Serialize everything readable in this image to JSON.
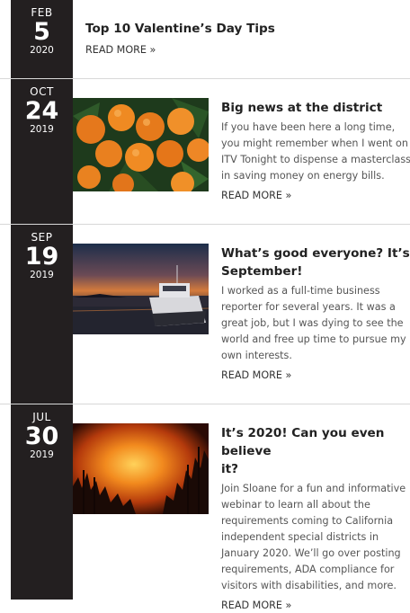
{
  "posts": [
    {
      "month": "FEB",
      "day": "5",
      "year": "2020",
      "title": "Top 10 Valentine’s Day Tips",
      "read_more": "READ MORE »",
      "body_lines": []
    },
    {
      "month": "OCT",
      "day": "24",
      "year": "2019",
      "title_lines": [
        "Big news at the district"
      ],
      "body_lines": [
        "If you have been here a long time,",
        "you might remember when I went on",
        "ITV Tonight to dispense a masterclass",
        "in saving money on energy bills."
      ],
      "read_more": "READ MORE »",
      "image": "oranges-photo"
    },
    {
      "month": "SEP",
      "day": "19",
      "year": "2019",
      "title_lines": [
        "What’s good everyone? It’s",
        "September!"
      ],
      "body_lines": [
        "I worked as a full-time business",
        "reporter for several years. It was a",
        "great job, but I was dying to see the",
        "world and free up time to pursue my",
        "own interests."
      ],
      "read_more": "READ MORE »",
      "image": "boat-sunset-photo"
    },
    {
      "month": "JUL",
      "day": "30",
      "year": "2019",
      "title_lines": [
        "It’s 2020! Can you even believe",
        "it?"
      ],
      "body_lines": [
        "Join Sloane for a fun and informative",
        "webinar to learn all about the",
        "requirements coming to California",
        "independent special districts in",
        "January 2020. We’ll go over posting",
        "requirements, ADA compliance for",
        "visitors with disabilities, and more."
      ],
      "read_more": "READ MORE »",
      "image": "wildfire-photo"
    }
  ]
}
